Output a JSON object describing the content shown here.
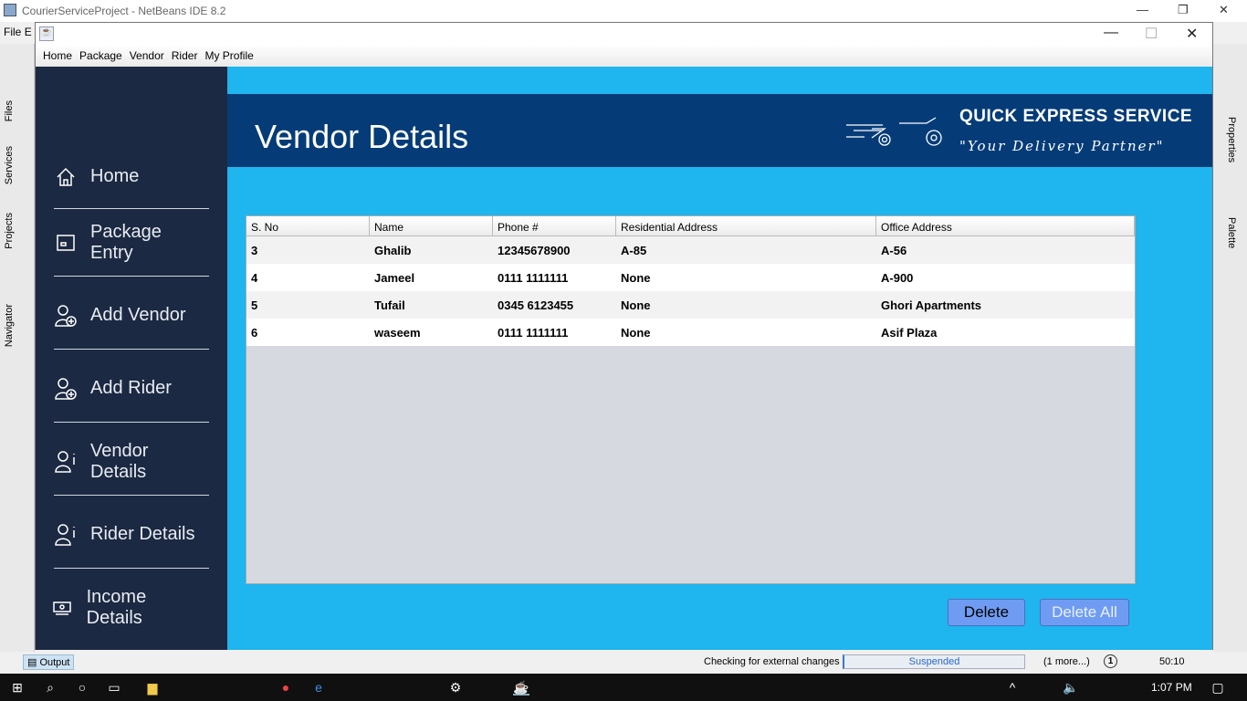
{
  "ide": {
    "title": "CourierServiceProject - NetBeans IDE 8.2",
    "menu": [
      "File",
      "E"
    ],
    "left_tabs": [
      "Files",
      "Services",
      "Projects",
      "Navigator"
    ],
    "right_tabs": [
      "Properties",
      "Palette"
    ],
    "status": {
      "output_tab": "Output",
      "message": "Checking for external changes",
      "progress": "Suspended",
      "more": "(1 more...)",
      "notifications": "1",
      "position": "50:10"
    }
  },
  "app": {
    "menu": [
      "Home",
      "Package",
      "Vendor",
      "Rider",
      "My Profile"
    ],
    "sidebar": [
      {
        "label": "Home",
        "icon": "home-icon"
      },
      {
        "label": "Package Entry",
        "icon": "package-icon"
      },
      {
        "label": "Add Vendor",
        "icon": "add-user-icon"
      },
      {
        "label": "Add Rider",
        "icon": "add-user-icon"
      },
      {
        "label": "Vendor Details",
        "icon": "user-info-icon"
      },
      {
        "label": "Rider Details",
        "icon": "user-info-icon"
      },
      {
        "label": "Income Details",
        "icon": "money-icon"
      }
    ],
    "header": {
      "title": "Vendor Details",
      "brand": "QUICK EXPRESS SERVICE",
      "tagline": "\"Your Delivery Partner\""
    },
    "table": {
      "columns": [
        "S. No",
        "Name",
        "Phone #",
        "Residential Address",
        "Office Address"
      ],
      "rows": [
        [
          "3",
          "Ghalib",
          "12345678900",
          "A-85",
          "A-56"
        ],
        [
          "4",
          "Jameel",
          "0111 1111111",
          "None",
          "A-900"
        ],
        [
          "5",
          "Tufail",
          "0345 6123455",
          "None",
          "Ghori Apartments"
        ],
        [
          "6",
          "waseem",
          "0111 1111111",
          "None",
          "Asif Plaza"
        ]
      ]
    },
    "buttons": {
      "delete": "Delete",
      "delete_all": "Delete All"
    }
  },
  "taskbar": {
    "time": "1:07 PM"
  }
}
